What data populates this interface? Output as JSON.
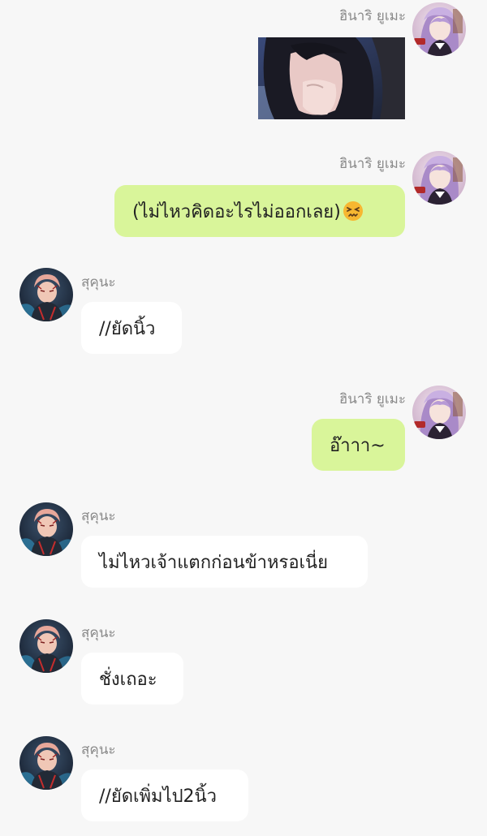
{
  "chat": {
    "messages": [
      {
        "sender": "ฮินาริ ยูเมะ",
        "type": "image",
        "icon": "photo-of-girl-covering-mouth"
      },
      {
        "sender": "ฮินาริ ยูเมะ",
        "type": "text",
        "text": "(ไม่ไหวคิดอะไรไม่ออกเลย)",
        "emoji": "confounded-face-emoji"
      },
      {
        "sender": "สุคุนะ",
        "type": "text",
        "text": "//ยัดนิ้ว"
      },
      {
        "sender": "ฮินาริ ยูเมะ",
        "type": "text",
        "text": "อ๊าาา~"
      },
      {
        "sender": "สุคุนะ",
        "type": "text",
        "text": "ไม่ไหวเจ้าแตกก่อนข้าหรอเนี่ย"
      },
      {
        "sender": "สุคุนะ",
        "type": "text",
        "text": "ชั่งเถอะ"
      },
      {
        "sender": "สุคุนะ",
        "type": "text",
        "text": "//ยัดเพิ่มไป2นิ้ว"
      }
    ]
  },
  "colors": {
    "background": "#f7f7f7",
    "outgoing_bubble": "#d9f59a",
    "incoming_bubble": "#ffffff",
    "sender_name": "#8a8a8a",
    "message_text": "#222222"
  }
}
